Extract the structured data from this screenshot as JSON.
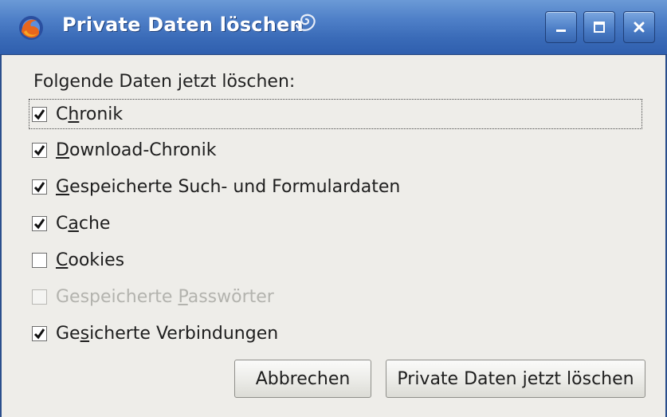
{
  "window": {
    "title": "Private Daten löschen",
    "title_swirl_icon": "kde-swirl-icon",
    "app_icon": "firefox-icon",
    "controls": {
      "minimize_icon": "minimize-icon",
      "maximize_icon": "maximize-icon",
      "close_icon": "close-icon"
    },
    "colors": {
      "titlebar": "#4a7cc5",
      "background": "#eeede9"
    }
  },
  "dialog": {
    "heading": "Folgende Daten jetzt löschen:",
    "options": [
      {
        "pre": "C",
        "key": "h",
        "post": "ronik",
        "checked": true,
        "enabled": true
      },
      {
        "pre": "",
        "key": "D",
        "post": "ownload-Chronik",
        "checked": true,
        "enabled": true
      },
      {
        "pre": "",
        "key": "G",
        "post": "espeicherte Such- und Formulardaten",
        "checked": true,
        "enabled": true
      },
      {
        "pre": "C",
        "key": "a",
        "post": "che",
        "checked": true,
        "enabled": true
      },
      {
        "pre": "",
        "key": "C",
        "post": "ookies",
        "checked": false,
        "enabled": true
      },
      {
        "pre": "Gespeicherte ",
        "key": "P",
        "post": "asswörter",
        "checked": false,
        "enabled": false
      },
      {
        "pre": "Ge",
        "key": "s",
        "post": "icherte Verbindungen",
        "checked": true,
        "enabled": true
      }
    ],
    "buttons": {
      "cancel": "Abbrechen",
      "confirm": "Private Daten jetzt löschen"
    }
  }
}
